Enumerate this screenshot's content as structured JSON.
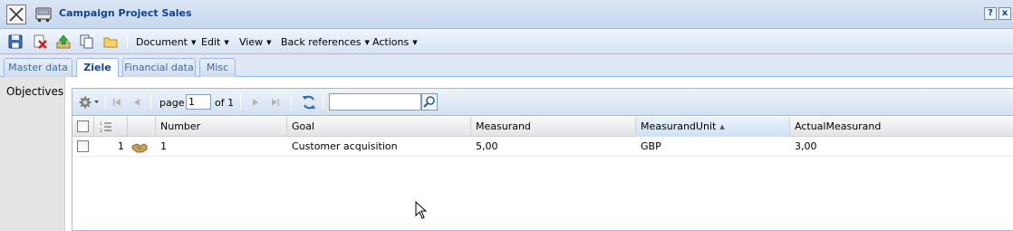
{
  "window": {
    "title": "Campaign Project Sales",
    "help_label": "?",
    "close_label": "x"
  },
  "toolbar": {
    "icons": [
      "save-icon",
      "delete-icon",
      "upload-icon",
      "copy-icon",
      "folder-icon"
    ],
    "menus": [
      {
        "label": "Document"
      },
      {
        "label": "Edit"
      },
      {
        "label": "View"
      },
      {
        "label": "Back references"
      },
      {
        "label": "Actions"
      }
    ]
  },
  "tabs": [
    {
      "label": "Master data",
      "active": false
    },
    {
      "label": "Ziele",
      "active": true
    },
    {
      "label": "Financial data",
      "active": false
    },
    {
      "label": "Misc",
      "active": false
    }
  ],
  "section_label": "Objectives",
  "paging": {
    "page_label": "page",
    "page_value": "1",
    "of_label": "of 1",
    "search_value": ""
  },
  "grid": {
    "columns": [
      "Number",
      "Goal",
      "Measurand",
      "MeasurandUnit",
      "ActualMeasurand"
    ],
    "sorted_column": "MeasurandUnit",
    "rows": [
      {
        "rownum": "1",
        "number": "1",
        "goal": "Customer acquisition",
        "measurand": "5,00",
        "unit": "GBP",
        "actual": "3,00"
      }
    ]
  }
}
